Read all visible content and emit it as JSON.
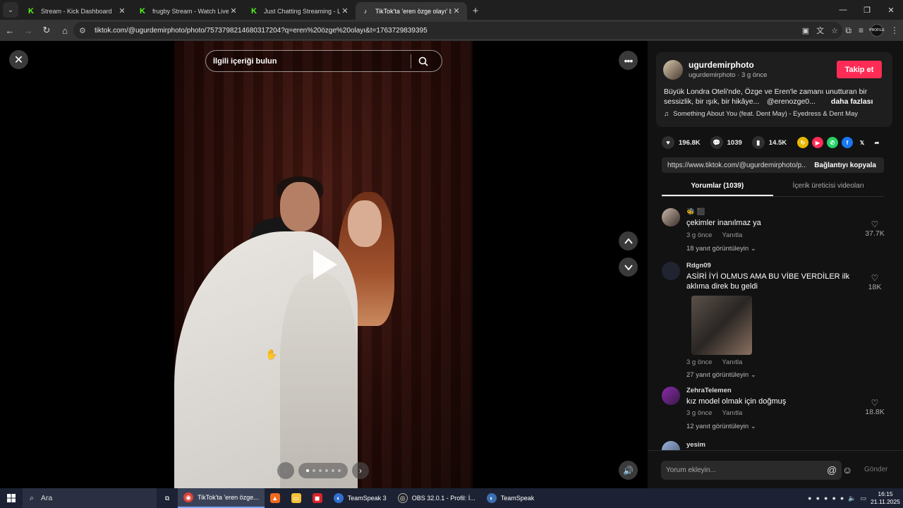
{
  "browser": {
    "tabs": [
      {
        "title": "Stream - Kick Dashboard",
        "icon": "kick-icon",
        "active": false
      },
      {
        "title": "frugby Stream - Watch Live on",
        "icon": "kick-icon",
        "active": false
      },
      {
        "title": "Just Chatting Streaming - Live",
        "icon": "kick-icon",
        "active": false
      },
      {
        "title": "TikTok'ta 'eren özge olayı' bula",
        "icon": "tiktok-icon",
        "active": true
      }
    ],
    "url": "tiktok.com/@ugurdemirphoto/photo/7573798214680317204?q=eren%20özge%20olayı&t=1763729839395",
    "profile_label": "PROFILE"
  },
  "viewer": {
    "search_placeholder": "İlgili içeriği bulun"
  },
  "post": {
    "username": "ugurdemirphoto",
    "subtitle": "ugurdemirphoto · 3 g önce",
    "follow_label": "Takip et",
    "description": "Büyük Londra Oteli'nde, Özge ve Eren'le zamanı unutturan bir sessizlik, bir ışık, bir hikâye... @erenozge0...",
    "more_label": "daha fazlası",
    "music": "Something About You (feat. Dent May) - Eyedress & Dent May",
    "likes": "196.8K",
    "comments_count": "1039",
    "saves": "14.5K",
    "link": "https://www.tiktok.com/@ugurdemirphoto/p...",
    "copy_link_label": "Bağlantıyı kopyala"
  },
  "panel_tabs": [
    {
      "label": "Yorumlar (1039)",
      "active": true
    },
    {
      "label": "İçerik üreticisi videoları",
      "active": false
    }
  ],
  "comments": [
    {
      "name": "🐝 ⬛",
      "text": "çekimler inanılmaz ya",
      "time": "3 g önce",
      "reply": "Yanıtla",
      "replies": "18 yanıt görüntüleyin ⌄",
      "likes": "37.7K"
    },
    {
      "name": "Rdgn09",
      "text": "ASİRİ İYİ OLMUS AMA BU VİBE VERDİLER ilk aklıma direk bu geldi",
      "time": "3 g önce",
      "reply": "Yanıtla",
      "replies": "27 yanıt görüntüleyin ⌄",
      "likes": "18K"
    },
    {
      "name": "ZehraTelemen",
      "text": "kız model olmak için doğmuş",
      "time": "3 g önce",
      "reply": "Yanıtla",
      "replies": "12 yanıt görüntüleyin ⌄",
      "likes": "18.8K"
    },
    {
      "name": "yesim",
      "text": "",
      "time": "",
      "reply": "",
      "replies": "",
      "likes": ""
    }
  ],
  "composer": {
    "placeholder": "Yorum ekleyin...",
    "send_label": "Gönder"
  },
  "taskbar": {
    "search_label": "Ara",
    "items": [
      {
        "label": "TikTok'ta 'eren özge...",
        "active": true
      },
      {
        "label": "",
        "active": false
      },
      {
        "label": "",
        "active": false
      },
      {
        "label": "",
        "active": false
      },
      {
        "label": "TeamSpeak 3",
        "active": false
      },
      {
        "label": "OBS 32.0.1 - Profil: İ...",
        "active": false
      },
      {
        "label": "TeamSpeak",
        "active": false
      }
    ],
    "time": "16:15",
    "date": "21.11.2025"
  },
  "colors": {
    "accent": "#fe2c55",
    "panel_bg": "#121212"
  }
}
